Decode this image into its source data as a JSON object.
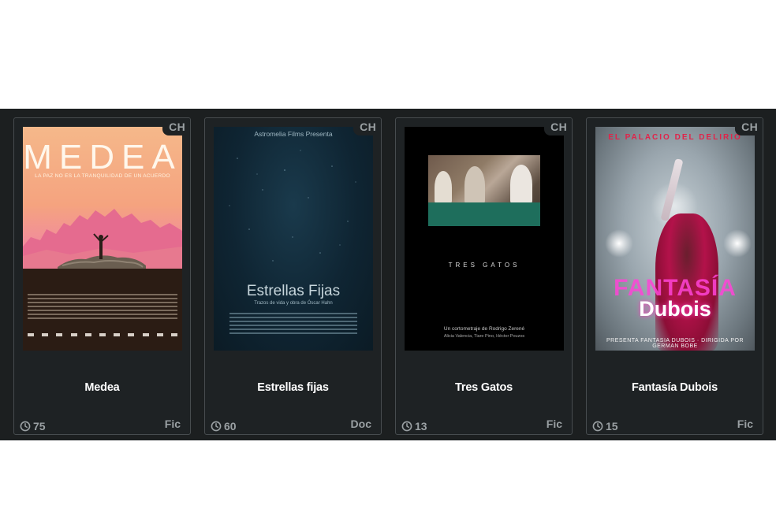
{
  "films": [
    {
      "title": "Medea",
      "country": "CH",
      "duration": "75",
      "genre": "Fic",
      "poster": {
        "big_title": "MEDEA",
        "tagline": "LA PAZ NO ES LA TRANQUILIDAD DE UN ACUERDO"
      }
    },
    {
      "title": "Estrellas fijas",
      "country": "CH",
      "duration": "60",
      "genre": "Doc",
      "poster": {
        "presents": "Astromelia Films Presenta",
        "big_title": "Estrellas Fijas",
        "subtitle": "Trazos de vida y obra de Óscar Hahn"
      }
    },
    {
      "title": "Tres Gatos",
      "country": "CH",
      "duration": "13",
      "genre": "Fic",
      "poster": {
        "big_title": "TRES GATOS",
        "credit_line1": "Un cortometraje de Rodrigo Zerené",
        "credit_line2": "Alicia Valencia, Tiare Pino, Héctor Pouzos"
      }
    },
    {
      "title": "Fantasía Dubois",
      "country": "CH",
      "duration": "15",
      "genre": "Fic",
      "poster": {
        "header": "EL PALACIO DEL DELIRIO",
        "word1": "FANTASÍA",
        "word2": "Dubois",
        "footer": "PRESENTA FANTASIA DUBOIS · DIRIGIDA POR GERMAN BOBE"
      }
    }
  ],
  "icons": {
    "duration": "clock-icon"
  },
  "colors": {
    "strip": "#1c1f20",
    "card": "#1e2224",
    "border": "#474c4f",
    "muted": "#9aa0a3"
  }
}
